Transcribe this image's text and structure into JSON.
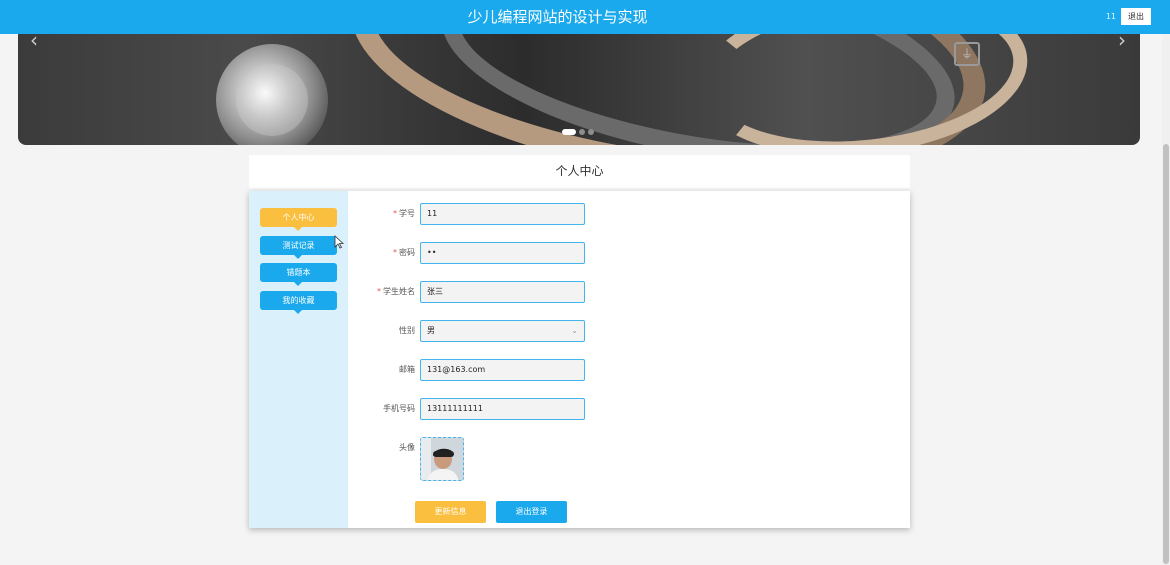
{
  "header": {
    "title": "少儿编程网站的设计与实现",
    "user_id": "11",
    "logout_label": "退出"
  },
  "banner": {
    "slide_count": 3,
    "active_slide": 1
  },
  "page_title": "个人中心",
  "sidebar": {
    "items": [
      {
        "label": "个人中心",
        "active": true
      },
      {
        "label": "测试记录",
        "active": false
      },
      {
        "label": "错题本",
        "active": false
      },
      {
        "label": "我的收藏",
        "active": false
      }
    ]
  },
  "form": {
    "student_no": {
      "label": "学号",
      "required": true,
      "value": "11"
    },
    "password": {
      "label": "密码",
      "required": true,
      "value": "••"
    },
    "student_name": {
      "label": "学生姓名",
      "required": true,
      "value": "张三"
    },
    "gender": {
      "label": "性别",
      "required": false,
      "value": "男"
    },
    "email": {
      "label": "邮箱",
      "required": false,
      "value": "131@163.com"
    },
    "phone": {
      "label": "手机号码",
      "required": false,
      "value": "13111111111"
    },
    "avatar": {
      "label": "头像"
    }
  },
  "buttons": {
    "update_label": "更新信息",
    "logout_label": "退出登录"
  },
  "colors": {
    "primary": "#1aa9ec",
    "accent": "#fbbf3f",
    "sidebar_bg": "#daf0fb",
    "required": "#e05a4c"
  }
}
